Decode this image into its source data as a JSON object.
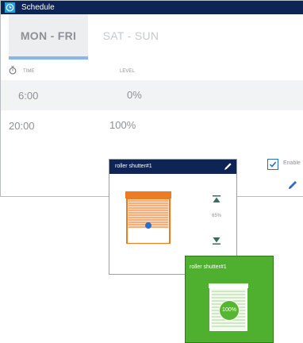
{
  "window": {
    "title": "Schedule"
  },
  "tabs": [
    {
      "label": "MON - FRI",
      "active": true
    },
    {
      "label": "SAT - SUN",
      "active": false
    }
  ],
  "columns": {
    "time": "TIME",
    "level": "LEVEL"
  },
  "rows": [
    {
      "time": "6:00",
      "level": "0%"
    },
    {
      "time": "20:00",
      "level": "100%"
    }
  ],
  "enable": {
    "label": "Enable",
    "checked": true
  },
  "shutter_card": {
    "name": "roller shutter#1",
    "level": "65%",
    "icons": [
      "edit-icon",
      "shutter-icon",
      "arrow-up-icon",
      "arrow-down-icon"
    ]
  },
  "shutter_tile": {
    "name": "roller shutter#1",
    "level": "100%"
  },
  "colors": {
    "header_navy": "#0e2454",
    "accent_blue": "#1fa3e0",
    "tab_underline": "#89b6e6",
    "shutter_orange": "#f07a1e",
    "tile_green": "#4eb02e"
  }
}
